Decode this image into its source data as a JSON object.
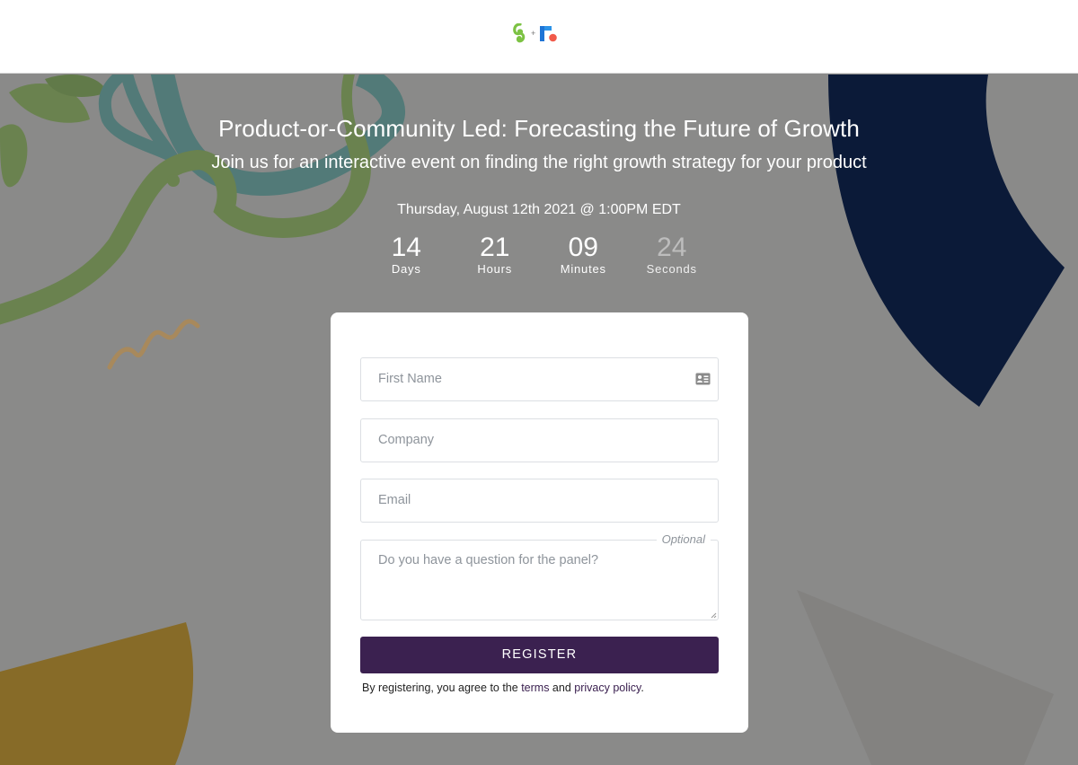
{
  "header": {
    "logo_left": "gainsight-chameleon-logo",
    "logo_separator": "+",
    "logo_right": "r-logo"
  },
  "event": {
    "title": "Product-or-Community Led: Forecasting the Future of Growth",
    "subtitle": "Join us for an interactive event on finding the right growth strategy for your product",
    "date": "Thursday, August 12th 2021 @ 1:00PM EDT"
  },
  "countdown": [
    {
      "value": "14",
      "label": "Days"
    },
    {
      "value": "21",
      "label": "Hours"
    },
    {
      "value": "09",
      "label": "Minutes"
    },
    {
      "value": "24",
      "label": "Seconds"
    }
  ],
  "form": {
    "first_name": {
      "placeholder": "First Name",
      "value": "",
      "icon": "contact-card-icon"
    },
    "company": {
      "placeholder": "Company",
      "value": ""
    },
    "email": {
      "placeholder": "Email",
      "value": ""
    },
    "question": {
      "placeholder": "Do you have a question for the panel?",
      "value": "",
      "tag": "Optional"
    },
    "submit_label": "REGISTER",
    "legal": {
      "prefix": "By registering, you agree to the ",
      "terms": "terms",
      "and": " and ",
      "privacy": "privacy policy",
      "suffix": "."
    }
  },
  "colors": {
    "overlay_bg": "#8a8a89",
    "button": "#3b2150",
    "navy_shape": "#0b1a38",
    "gold_shape": "#876b28",
    "green_vine": "#6a824f",
    "teal_ribbon": "#527a78"
  }
}
